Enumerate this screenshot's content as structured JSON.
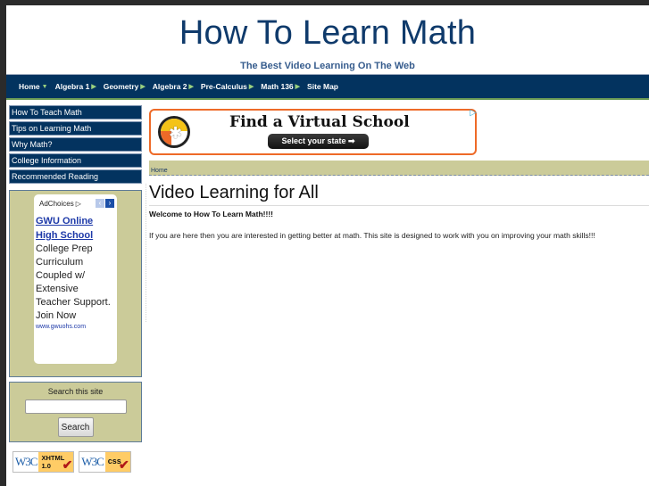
{
  "header": {
    "title": "How To Learn Math",
    "tagline": "The Best Video Learning On The Web"
  },
  "nav": {
    "items": [
      {
        "label": "Home",
        "arrow": "▼"
      },
      {
        "label": "Algebra 1",
        "arrow": "▶"
      },
      {
        "label": "Geometry",
        "arrow": "▶"
      },
      {
        "label": "Algebra 2",
        "arrow": "▶"
      },
      {
        "label": "Pre-Calculus",
        "arrow": "▶"
      },
      {
        "label": "Math 136",
        "arrow": "▶"
      },
      {
        "label": "Site Map",
        "arrow": ""
      }
    ]
  },
  "sidebar": {
    "links": [
      "How To Teach Math",
      "Tips on Learning Math",
      "Why Math?",
      "College Information",
      "Recommended Reading"
    ],
    "ad": {
      "choices_label": "AdChoices",
      "choices_icon": "▷",
      "prev_icon": "‹",
      "next_icon": "›",
      "title": "GWU Online High School",
      "body": "College Prep Curriculum Coupled w/ Extensive Teacher Support. Join Now",
      "url": "www.gwuohs.com"
    },
    "search": {
      "label": "Search this site",
      "input_value": "",
      "button_label": "Search"
    },
    "badges": [
      {
        "w3c": "W3C",
        "kind_line1": "XHTML",
        "kind_line2": "1.0",
        "check": "✔"
      },
      {
        "w3c": "W3C",
        "kind_line1": "css",
        "kind_line2": "",
        "check": "✔"
      }
    ]
  },
  "top_ad": {
    "headline": "Find a Virtual School",
    "cta": "Select your state ➡",
    "choices_icon": "▷"
  },
  "breadcrumb": {
    "home": "Home"
  },
  "main": {
    "title": "Video Learning for All",
    "welcome": "Welcome to How To Learn Math!!!!",
    "intro": "If you are here then you are interested in getting better at math.  This site is designed to work with you on improving your math skills!!!"
  },
  "colors": {
    "nav_bg": "#03335f",
    "title_blue": "#0f3a6b",
    "box_khaki": "#cbcb99",
    "ad_orange": "#ee6a28"
  }
}
